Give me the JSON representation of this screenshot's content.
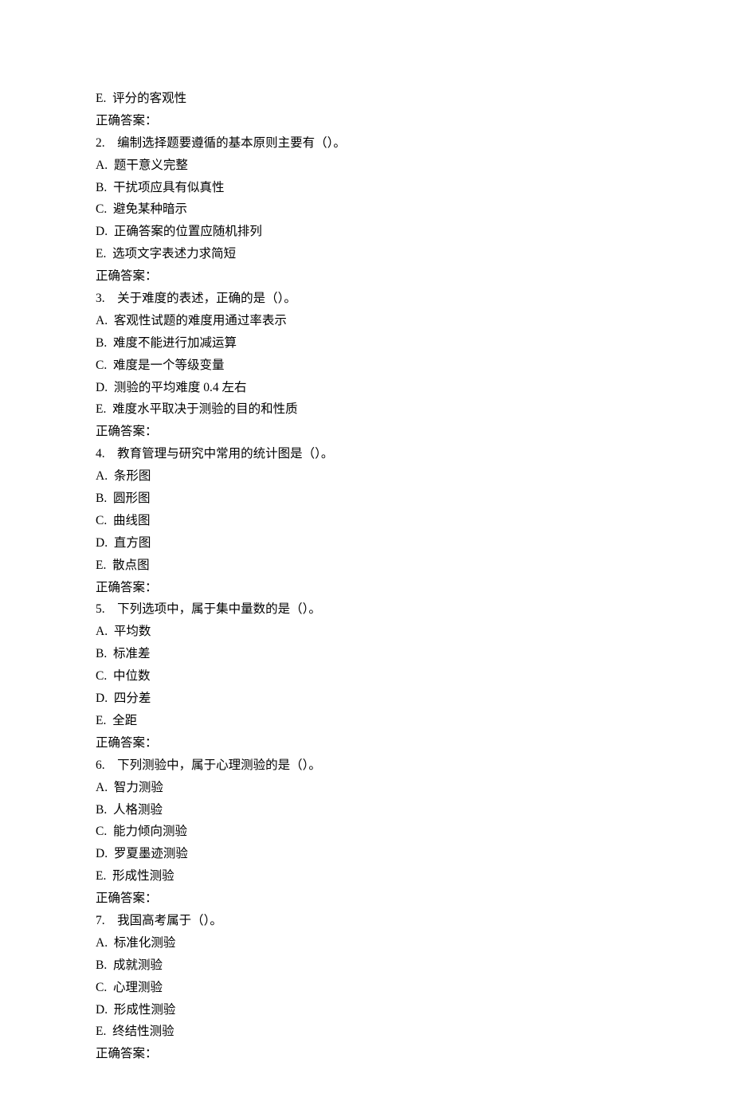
{
  "fragment": {
    "option_e": "E.  评分的客观性",
    "answer_label": "正确答案："
  },
  "questions": [
    {
      "number": "2.",
      "text": "编制选择题要遵循的基本原则主要有（）。",
      "options": [
        "A.  题干意义完整",
        "B.  干扰项应具有似真性",
        "C.  避免某种暗示",
        "D.  正确答案的位置应随机排列",
        "E.  选项文字表述力求简短"
      ],
      "answer_label": "正确答案："
    },
    {
      "number": "3.",
      "text": "关于难度的表述，正确的是（）。",
      "options": [
        "A.  客观性试题的难度用通过率表示",
        "B.  难度不能进行加减运算",
        "C.  难度是一个等级变量",
        "D.  测验的平均难度 0.4 左右",
        "E.  难度水平取决于测验的目的和性质"
      ],
      "answer_label": "正确答案："
    },
    {
      "number": "4.",
      "text": "教育管理与研究中常用的统计图是（）。",
      "options": [
        "A.  条形图",
        "B.  圆形图",
        "C.  曲线图",
        "D.  直方图",
        "E.  散点图"
      ],
      "answer_label": "正确答案："
    },
    {
      "number": "5.",
      "text": "下列选项中，属于集中量数的是（）。",
      "options": [
        "A.  平均数",
        "B.  标准差",
        "C.  中位数",
        "D.  四分差",
        "E.  全距"
      ],
      "answer_label": "正确答案："
    },
    {
      "number": "6.",
      "text": "下列测验中，属于心理测验的是（）。",
      "options": [
        "A.  智力测验",
        "B.  人格测验",
        "C.  能力倾向测验",
        "D.  罗夏墨迹测验",
        "E.  形成性测验"
      ],
      "answer_label": "正确答案："
    },
    {
      "number": "7.",
      "text": "我国高考属于（）。",
      "options": [
        "A.  标准化测验",
        "B.  成就测验",
        "C.  心理测验",
        "D.  形成性测验",
        "E.  终结性测验"
      ],
      "answer_label": "正确答案："
    }
  ]
}
